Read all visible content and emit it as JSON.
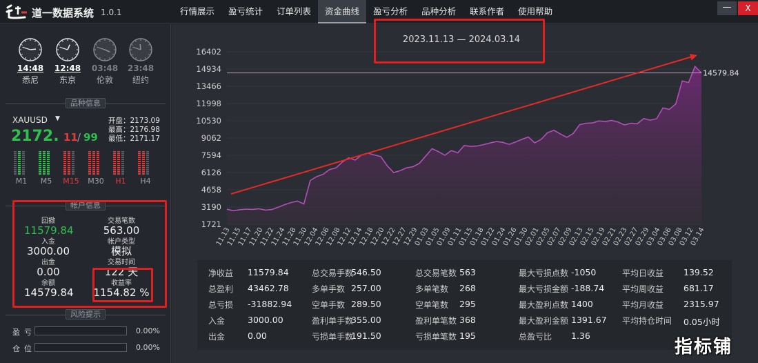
{
  "app": {
    "title": "道一数据系统",
    "version": "1.0.1"
  },
  "menu": [
    "行情展示",
    "盈亏统计",
    "订单列表",
    "资金曲线",
    "盈亏分析",
    "品种分析",
    "联系作者",
    "使用帮助"
  ],
  "menu_active": 3,
  "window": {
    "minimize": "—",
    "close": "X"
  },
  "clocks": [
    {
      "time": "14:48",
      "city": "悉尼"
    },
    {
      "time": "12:48",
      "city": "东京"
    },
    {
      "time": "03:48",
      "city": "伦敦"
    },
    {
      "time": "23:48",
      "city": "纽约"
    }
  ],
  "sections": {
    "symbol_info": "品种信息",
    "account_info": "帐户信息",
    "risk": "风险提示"
  },
  "symbol": {
    "name": "XAUUSD",
    "price_main": "2172.",
    "price_mid": "11",
    "price_sep": "/",
    "price_last": "99",
    "open_label": "开盘：",
    "open": "2173.09",
    "high_label": "最高：",
    "high": "2176.98",
    "low_label": "最低：",
    "low": "2171.17"
  },
  "timeframes": [
    {
      "label": "M1",
      "color": "gray",
      "bars": [
        "#5a5d63",
        "#2fbf4f",
        "#5a5d63"
      ]
    },
    {
      "label": "M5",
      "color": "gray",
      "bars": [
        "#2fbf4f",
        "#2fbf4f",
        "#2fbf4f"
      ]
    },
    {
      "label": "M15",
      "color": "red",
      "bars": [
        "#e23a3a",
        "#e23a3a",
        "#5a5d63"
      ]
    },
    {
      "label": "M30",
      "color": "gray",
      "bars": [
        "#e23a3a",
        "#e23a3a",
        "#e23a3a"
      ]
    },
    {
      "label": "H1",
      "color": "red",
      "bars": [
        "#e23a3a",
        "#e23a3a",
        "#5a5d63"
      ]
    },
    {
      "label": "H4",
      "color": "gray",
      "bars": [
        "#e23a3a",
        "#e23a3a",
        "#5a5d63"
      ]
    }
  ],
  "account": {
    "drawdown_label": "回撤",
    "drawdown": "11579.84",
    "deposit_label": "入金",
    "deposit": "3000.00",
    "withdraw_label": "出金",
    "withdraw": "0.00",
    "balance_label": "余额",
    "balance": "14579.84",
    "trades_label": "交易笔数",
    "trades": "563.00",
    "account_type_label": "帐户类型",
    "account_type": "模拟",
    "trade_time_label": "交易时间",
    "trade_time": "122 天",
    "return_label": "收益率",
    "return": "1154.82 %"
  },
  "risk": [
    {
      "label": "盈亏",
      "value": "0.00%",
      "fill": 0
    },
    {
      "label": "仓位",
      "value": "0.00%",
      "fill": 0
    }
  ],
  "date_range": "2023.11.13 — 2024.03.14",
  "chart_data": {
    "type": "area",
    "title": "2023.11.13 — 2024.03.14",
    "last_value_label": "14579.84",
    "yticks": [
      1721,
      3190,
      4658,
      6126,
      7594,
      9062,
      10530,
      11998,
      13466,
      14934,
      16402
    ],
    "ylim": [
      1721,
      16402
    ],
    "xlabels": [
      "11.13",
      "11.15",
      "11.17",
      "11.20",
      "11.22",
      "11.24",
      "11.28",
      "11.30",
      "12.04",
      "12.06",
      "12.08",
      "12.12",
      "12.14",
      "12.18",
      "12.20",
      "12.22",
      "12.27",
      "12.29",
      "01.03",
      "01.05",
      "01.09",
      "01.11",
      "01.15",
      "01.18",
      "01.22",
      "01.24",
      "01.26",
      "01.30",
      "02.01",
      "02.05",
      "02.07",
      "02.09",
      "02.13",
      "02.15",
      "02.19",
      "02.21",
      "02.23",
      "02.27",
      "02.29",
      "03.04",
      "03.06",
      "03.08",
      "03.12",
      "03.14"
    ],
    "values": [
      3000,
      2880,
      2960,
      3010,
      2990,
      3040,
      2930,
      2980,
      3180,
      3390,
      3570,
      3700,
      3450,
      5450,
      5780,
      5980,
      6380,
      6520,
      7020,
      7380,
      7180,
      7620,
      7780,
      7620,
      7480,
      6700,
      6120,
      6280,
      6520,
      6620,
      6900,
      7520,
      8150,
      7900,
      7600,
      8000,
      7800,
      8420,
      8350,
      8380,
      8500,
      8640,
      8760,
      8700,
      8520,
      8720,
      8950,
      9150,
      8650,
      8950,
      9520,
      9720,
      9400,
      9120,
      9450,
      10200,
      10320,
      10340,
      10520,
      10460,
      10560,
      10420,
      10180,
      10320,
      10280,
      10720,
      10580,
      10700,
      11620,
      11500,
      11960,
      13920,
      13780,
      15150,
      14600
    ],
    "series": [
      {
        "name": "资金曲线",
        "color": "#b24fb8"
      }
    ],
    "trend_arrow_color": "#e52a25"
  },
  "stats": [
    [
      {
        "label": "净收益",
        "value": "11579.84"
      },
      {
        "label": "总盈利",
        "value": "43462.78"
      },
      {
        "label": "总亏损",
        "value": "-31882.94"
      },
      {
        "label": "入金",
        "value": "3000.00"
      },
      {
        "label": "出金",
        "value": "0.00"
      }
    ],
    [
      {
        "label": "总交易手数",
        "value": "546.50"
      },
      {
        "label": "多单手数",
        "value": "257.00"
      },
      {
        "label": "空单手数",
        "value": "289.50"
      },
      {
        "label": "盈利单手数",
        "value": "355.00"
      },
      {
        "label": "亏损单手数",
        "value": "191.50"
      }
    ],
    [
      {
        "label": "总交易笔数",
        "value": "563"
      },
      {
        "label": "多单笔数",
        "value": "268"
      },
      {
        "label": "空单笔数",
        "value": "295"
      },
      {
        "label": "盈利单笔数",
        "value": "368"
      },
      {
        "label": "亏损单笔数",
        "value": "195"
      }
    ],
    [
      {
        "label": "最大亏损点数",
        "value": "-1050"
      },
      {
        "label": "最大亏损金额",
        "value": "-188.74"
      },
      {
        "label": "最大盈利点数",
        "value": "1400"
      },
      {
        "label": "最大盈利金额",
        "value": "1391.67"
      },
      {
        "label": "总盈亏比",
        "value": "1.36"
      }
    ],
    [
      {
        "label": "平均日收益",
        "value": "139.52"
      },
      {
        "label": "平均周收益",
        "value": "681.17"
      },
      {
        "label": "平均月收益",
        "value": "2315.97"
      },
      {
        "label": "平均持仓时间",
        "value": "0.05小时"
      }
    ]
  ],
  "watermark": "指标铺"
}
